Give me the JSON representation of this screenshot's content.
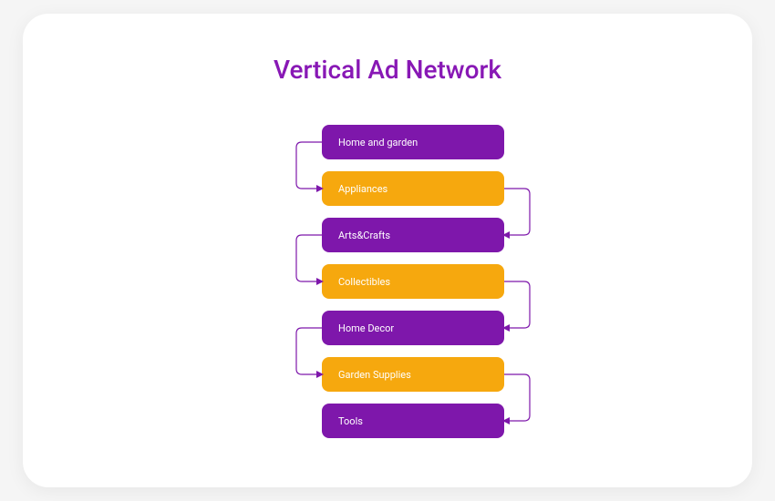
{
  "title": "Vertical Ad Network",
  "colors": {
    "purple": "#7e17ab",
    "orange": "#f6a80e",
    "title": "#8818b5"
  },
  "blocks": [
    {
      "label": "Home and garden",
      "style": "purple"
    },
    {
      "label": "Appliances",
      "style": "orange"
    },
    {
      "label": "Arts&Crafts",
      "style": "purple"
    },
    {
      "label": "Collectibles",
      "style": "orange"
    },
    {
      "label": "Home Decor",
      "style": "purple"
    },
    {
      "label": "Garden Supplies",
      "style": "orange"
    },
    {
      "label": "Tools",
      "style": "purple"
    }
  ]
}
